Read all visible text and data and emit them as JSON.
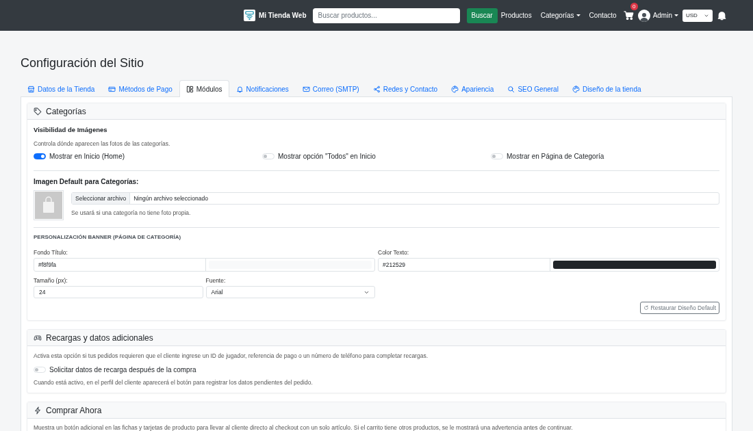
{
  "navbar": {
    "brand": "Mi Tienda Web",
    "search": {
      "placeholder": "Buscar productos..."
    },
    "search_button": "Buscar",
    "links": [
      {
        "label": "Productos",
        "dropdown": false
      },
      {
        "label": "Categorías",
        "dropdown": true
      },
      {
        "label": "Contacto",
        "dropdown": false
      }
    ],
    "cart_count": "0",
    "user": "Admin",
    "currency": "USD"
  },
  "page_title": "Configuración del Sitio",
  "tabs": [
    {
      "label": "Datos de la Tienda",
      "selected": false
    },
    {
      "label": "Métodos de Pago",
      "selected": false
    },
    {
      "label": "Módulos",
      "selected": true
    },
    {
      "label": "Notificaciones",
      "selected": false
    },
    {
      "label": "Correo (SMTP)",
      "selected": false
    },
    {
      "label": "Redes y Contacto",
      "selected": false
    },
    {
      "label": "Apariencia",
      "selected": false
    },
    {
      "label": "SEO General",
      "selected": false
    },
    {
      "label": "Diseño de la tienda",
      "selected": false
    }
  ],
  "sections": [
    {
      "kind": "categories",
      "title": "Categorías",
      "visibility": {
        "heading": "Visibilidad de Imágenes",
        "description": "Controla dónde aparecen las fotos de las categorías.",
        "toggles": [
          {
            "label": "Mostrar en Inicio (Home)",
            "on": true
          },
          {
            "label": "Mostrar opción \"Todos\" en Inicio",
            "on": false
          },
          {
            "label": "Mostrar en Página de Categoría",
            "on": false
          }
        ]
      },
      "default_image": {
        "heading": "Imagen Default para Categorías:",
        "file_button": "Seleccionar archivo",
        "file_status": "Ningún archivo seleccionado",
        "hint": "Se usará si una categoría no tiene foto propia."
      },
      "banner": {
        "heading": "PERSONALIZACIÓN BANNER (PÁGINA DE CATEGORÍA)",
        "fields": [
          {
            "kind": "color",
            "label": "Fondo Título:",
            "value": "#f8f9fa",
            "color": "#f8f9fa"
          },
          {
            "kind": "color",
            "label": "Color Texto:",
            "value": "#212529",
            "color": "#212529"
          },
          {
            "kind": "number",
            "label": "Tamaño (px):",
            "value": "24"
          },
          {
            "kind": "select",
            "label": "Fuente:",
            "value": "Arial"
          }
        ],
        "reset_button": "Restaurar Diseño Default"
      }
    },
    {
      "kind": "recharge",
      "title": "Recargas y datos adicionales",
      "description": "Activa esta opción si tus pedidos requieren que el cliente ingrese un ID de jugador, referencia de pago o un número de teléfono para completar recargas.",
      "toggles": [
        {
          "label": "Solicitar datos de recarga después de la compra",
          "on": false
        }
      ],
      "note": "Cuando está activo, en el perfil del cliente aparecerá el botón para registrar los datos pendientes del pedido."
    },
    {
      "kind": "buy_now",
      "title": "Comprar Ahora",
      "description": "Muestra un botón adicional en las fichas y tarjetas de producto para llevar al cliente directo al checkout con un solo artículo. Si el carrito tiene otros productos, se le mostrará una advertencia antes de continuar."
    }
  ]
}
